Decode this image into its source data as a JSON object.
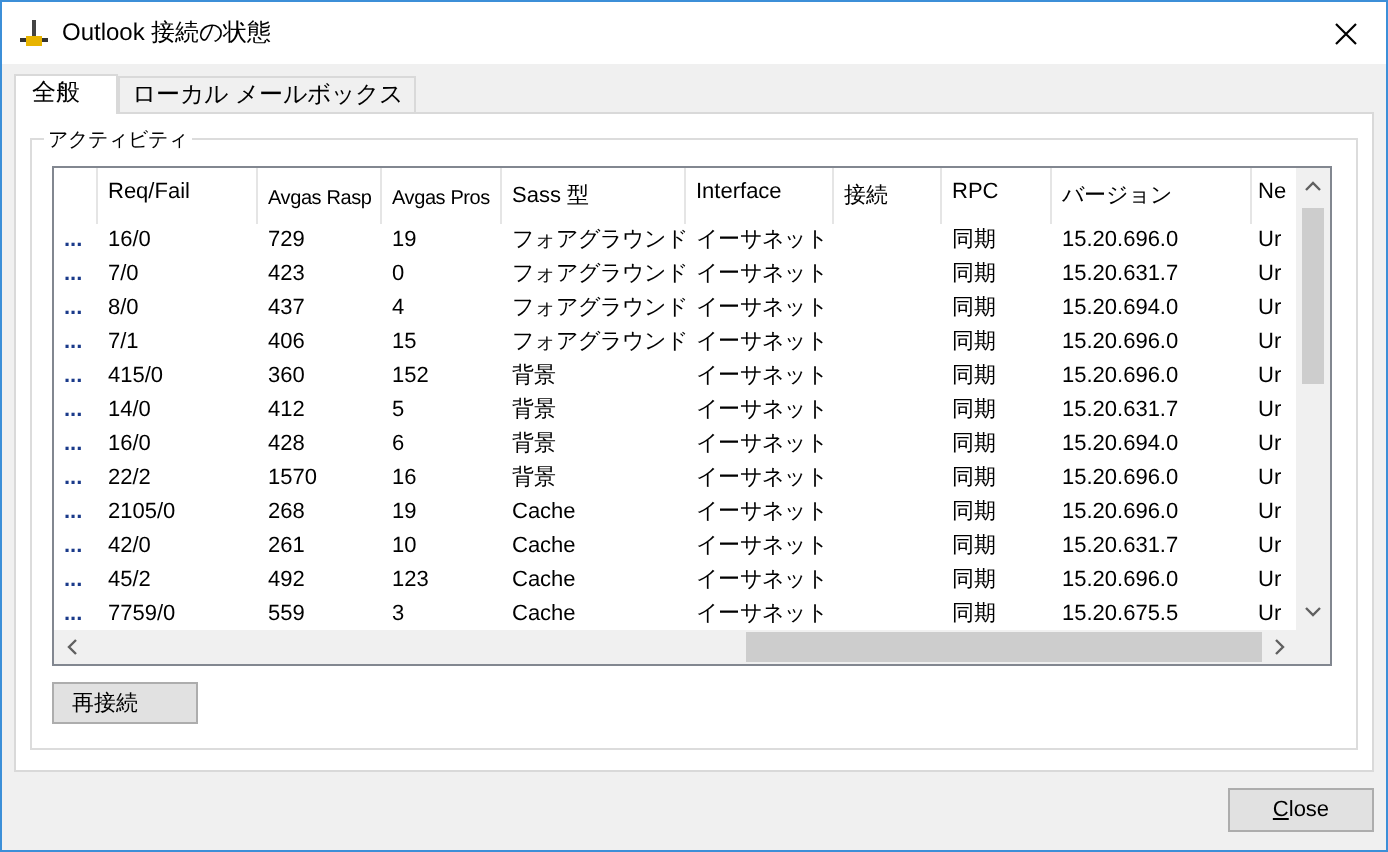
{
  "window": {
    "title": "Outlook 接続の状態"
  },
  "tabs": [
    {
      "label": "全般",
      "selected": true
    },
    {
      "label": "ローカル メールボックス",
      "selected": false
    }
  ],
  "group": {
    "title": "アクティビティ"
  },
  "table": {
    "columns": [
      "",
      "Req/Fail",
      "Avgas Rasp",
      "Avgas Pros",
      "Sass 型",
      "Interface",
      "接続",
      "RPC",
      "バージョン",
      "Ne"
    ],
    "rows": [
      [
        "...",
        "16/0",
        "729",
        "19",
        "フォアグラウンド",
        "イーサネット",
        "",
        "同期",
        "15.20.696.0",
        "Ur"
      ],
      [
        "...",
        "7/0",
        "423",
        "0",
        "フォアグラウンド",
        "イーサネット",
        "",
        "同期",
        "15.20.631.7",
        "Ur"
      ],
      [
        "...",
        "8/0",
        "437",
        "4",
        "フォアグラウンド",
        "イーサネット",
        "",
        "同期",
        "15.20.694.0",
        "Ur"
      ],
      [
        "...",
        "7/1",
        "406",
        "15",
        "フォアグラウンド",
        "イーサネット",
        "",
        "同期",
        "15.20.696.0",
        "Ur"
      ],
      [
        "...",
        "415/0",
        "360",
        "152",
        "背景",
        "イーサネット",
        "",
        "同期",
        "15.20.696.0",
        "Ur"
      ],
      [
        "...",
        "14/0",
        "412",
        "5",
        "背景",
        "イーサネット",
        "",
        "同期",
        "15.20.631.7",
        "Ur"
      ],
      [
        "...",
        "16/0",
        "428",
        "6",
        "背景",
        "イーサネット",
        "",
        "同期",
        "15.20.694.0",
        "Ur"
      ],
      [
        "...",
        "22/2",
        "1570",
        "16",
        "背景",
        "イーサネット",
        "",
        "同期",
        "15.20.696.0",
        "Ur"
      ],
      [
        "...",
        "2105/0",
        "268",
        "19",
        "Cache",
        "イーサネット",
        "",
        "同期",
        "15.20.696.0",
        "Ur"
      ],
      [
        "...",
        "42/0",
        "261",
        "10",
        "Cache",
        "イーサネット",
        "",
        "同期",
        "15.20.631.7",
        "Ur"
      ],
      [
        "...",
        "45/2",
        "492",
        "123",
        "Cache",
        "イーサネット",
        "",
        "同期",
        "15.20.696.0",
        "Ur"
      ],
      [
        "...",
        "7759/0",
        "559",
        "3",
        "Cache",
        "イーサネット",
        "",
        "同期",
        "15.20.675.5",
        "Ur"
      ]
    ]
  },
  "reconnect_button": "再接続",
  "close_button": "Close"
}
